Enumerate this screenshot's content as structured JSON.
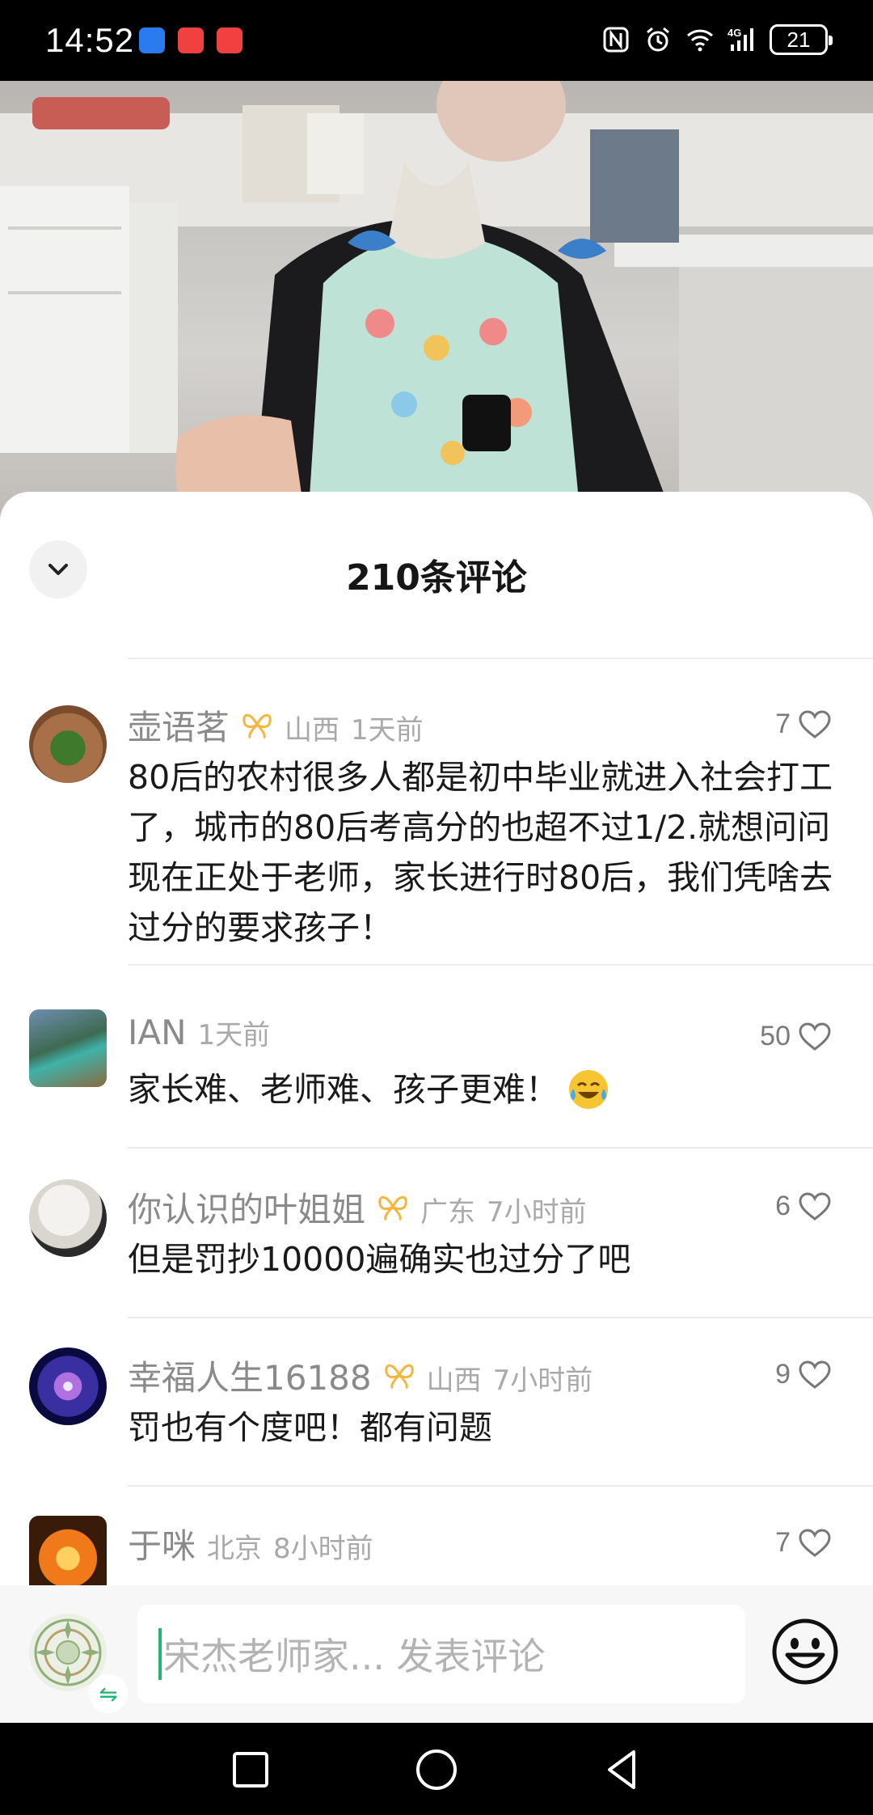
{
  "status_bar": {
    "time": "14:52",
    "network": "4G",
    "battery": "21"
  },
  "sheet": {
    "title": "210条评论",
    "collapse_icon": "chevron-down-icon"
  },
  "comments": [
    {
      "name": "壶语茗",
      "has_badge": true,
      "location": "山西",
      "time": "1天前",
      "likes": "7",
      "text": "80后的农村很多人都是初中毕业就进入社会打工了，城市的80后考高分的也超不过1/2.就想问问现在正处于老师，家长进行时80后，我们凭啥去过分的要求孩子！"
    },
    {
      "name": "IAN",
      "has_badge": false,
      "location": "",
      "time": "1天前",
      "likes": "50",
      "text": "家长难、老师难、孩子更难！",
      "emoji": "laugh-cry-emoji"
    },
    {
      "name": "你认识的叶姐姐",
      "has_badge": true,
      "location": "广东",
      "time": "7小时前",
      "likes": "6",
      "text": "但是罚抄10000遍确实也过分了吧"
    },
    {
      "name": "幸福人生16188",
      "has_badge": true,
      "location": "山西",
      "time": "7小时前",
      "likes": "9",
      "text": "罚也有个度吧！都有问题"
    },
    {
      "name": "于咪",
      "has_badge": false,
      "location": "北京",
      "time": "8小时前",
      "likes": "7",
      "text": ""
    }
  ],
  "input_bar": {
    "placeholder": "宋杰老师家... 发表评论",
    "emoji_icon": "smiley-icon"
  },
  "colors": {
    "accent_green": "#22b573",
    "badge_orange": "#f5b640",
    "text_primary": "#1a1a1a",
    "text_secondary": "#8a8a8a"
  }
}
